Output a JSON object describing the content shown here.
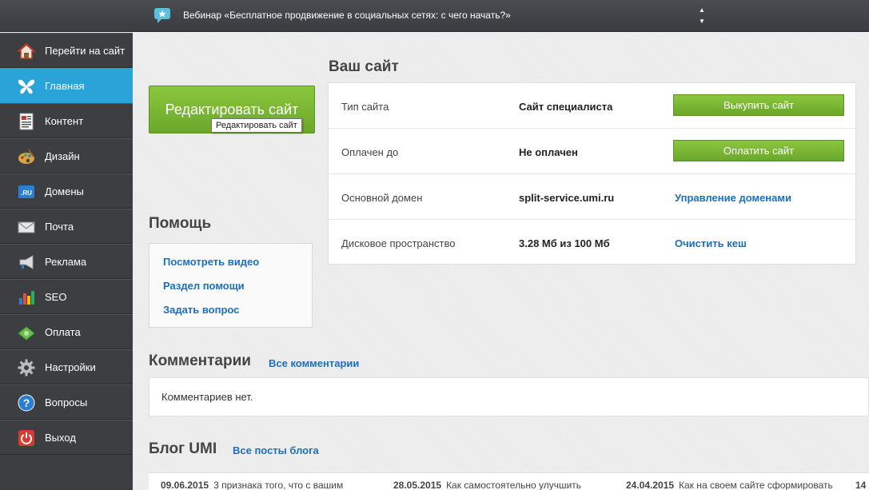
{
  "topbar": {
    "title": "Вебинар «Бесплатное продвижение в социальных сетях: с чего начать?»",
    "up_arrow": "▲",
    "down_arrow": "▼"
  },
  "sidebar": {
    "items": [
      {
        "label": "Перейти на сайт",
        "icon": "house-icon"
      },
      {
        "label": "Главная",
        "icon": "butterfly-icon",
        "active": true
      },
      {
        "label": "Контент",
        "icon": "document-icon"
      },
      {
        "label": "Дизайн",
        "icon": "palette-icon"
      },
      {
        "label": "Домены",
        "icon": "ru-domain-icon"
      },
      {
        "label": "Почта",
        "icon": "envelope-icon"
      },
      {
        "label": "Реклама",
        "icon": "megaphone-icon"
      },
      {
        "label": "SEO",
        "icon": "bar-chart-icon"
      },
      {
        "label": "Оплата",
        "icon": "money-icon"
      },
      {
        "label": "Настройки",
        "icon": "gear-icon"
      },
      {
        "label": "Вопросы",
        "icon": "question-icon"
      },
      {
        "label": "Выход",
        "icon": "power-icon"
      }
    ],
    "ru_badge": ".RU"
  },
  "main": {
    "edit_button": "Редактировать сайт",
    "edit_tooltip": "Редактировать сайт",
    "site_title": "Ваш сайт",
    "site_rows": [
      {
        "key": "Тип сайта",
        "value": "Сайт специалиста",
        "action": "Выкупить сайт",
        "action_type": "button"
      },
      {
        "key": "Оплачен до",
        "value": "Не оплачен",
        "action": "Оплатить сайт",
        "action_type": "button"
      },
      {
        "key": "Основной домен",
        "value": "split-service.umi.ru",
        "action": "Управление доменами",
        "action_type": "link"
      },
      {
        "key": "Дисковое пространство",
        "value": "3.28 Мб из 100 Мб",
        "action": "Очистить кеш",
        "action_type": "link"
      }
    ],
    "help_title": "Помощь",
    "help_links": [
      "Посмотреть видео",
      "Раздел помощи",
      "Задать вопрос"
    ],
    "comments_title": "Комментарии",
    "comments_all": "Все комментарии",
    "comments_empty": "Комментариев нет.",
    "blog_title": "Блог UMI",
    "blog_all": "Все посты блога",
    "blog_posts": [
      {
        "date": "09.06.2015",
        "title": "3 признака того, что с вашим"
      },
      {
        "date": "28.05.2015",
        "title": "Как самостоятельно улучшить"
      },
      {
        "date": "24.04.2015",
        "title": "Как на своем сайте сформировать"
      },
      {
        "date": "14",
        "title": ""
      }
    ]
  },
  "colors": {
    "accent_blue": "#2aa3d8",
    "button_green": "#7ab935",
    "link_blue": "#1a6fbf",
    "sidebar_bg": "#3c3e42"
  }
}
